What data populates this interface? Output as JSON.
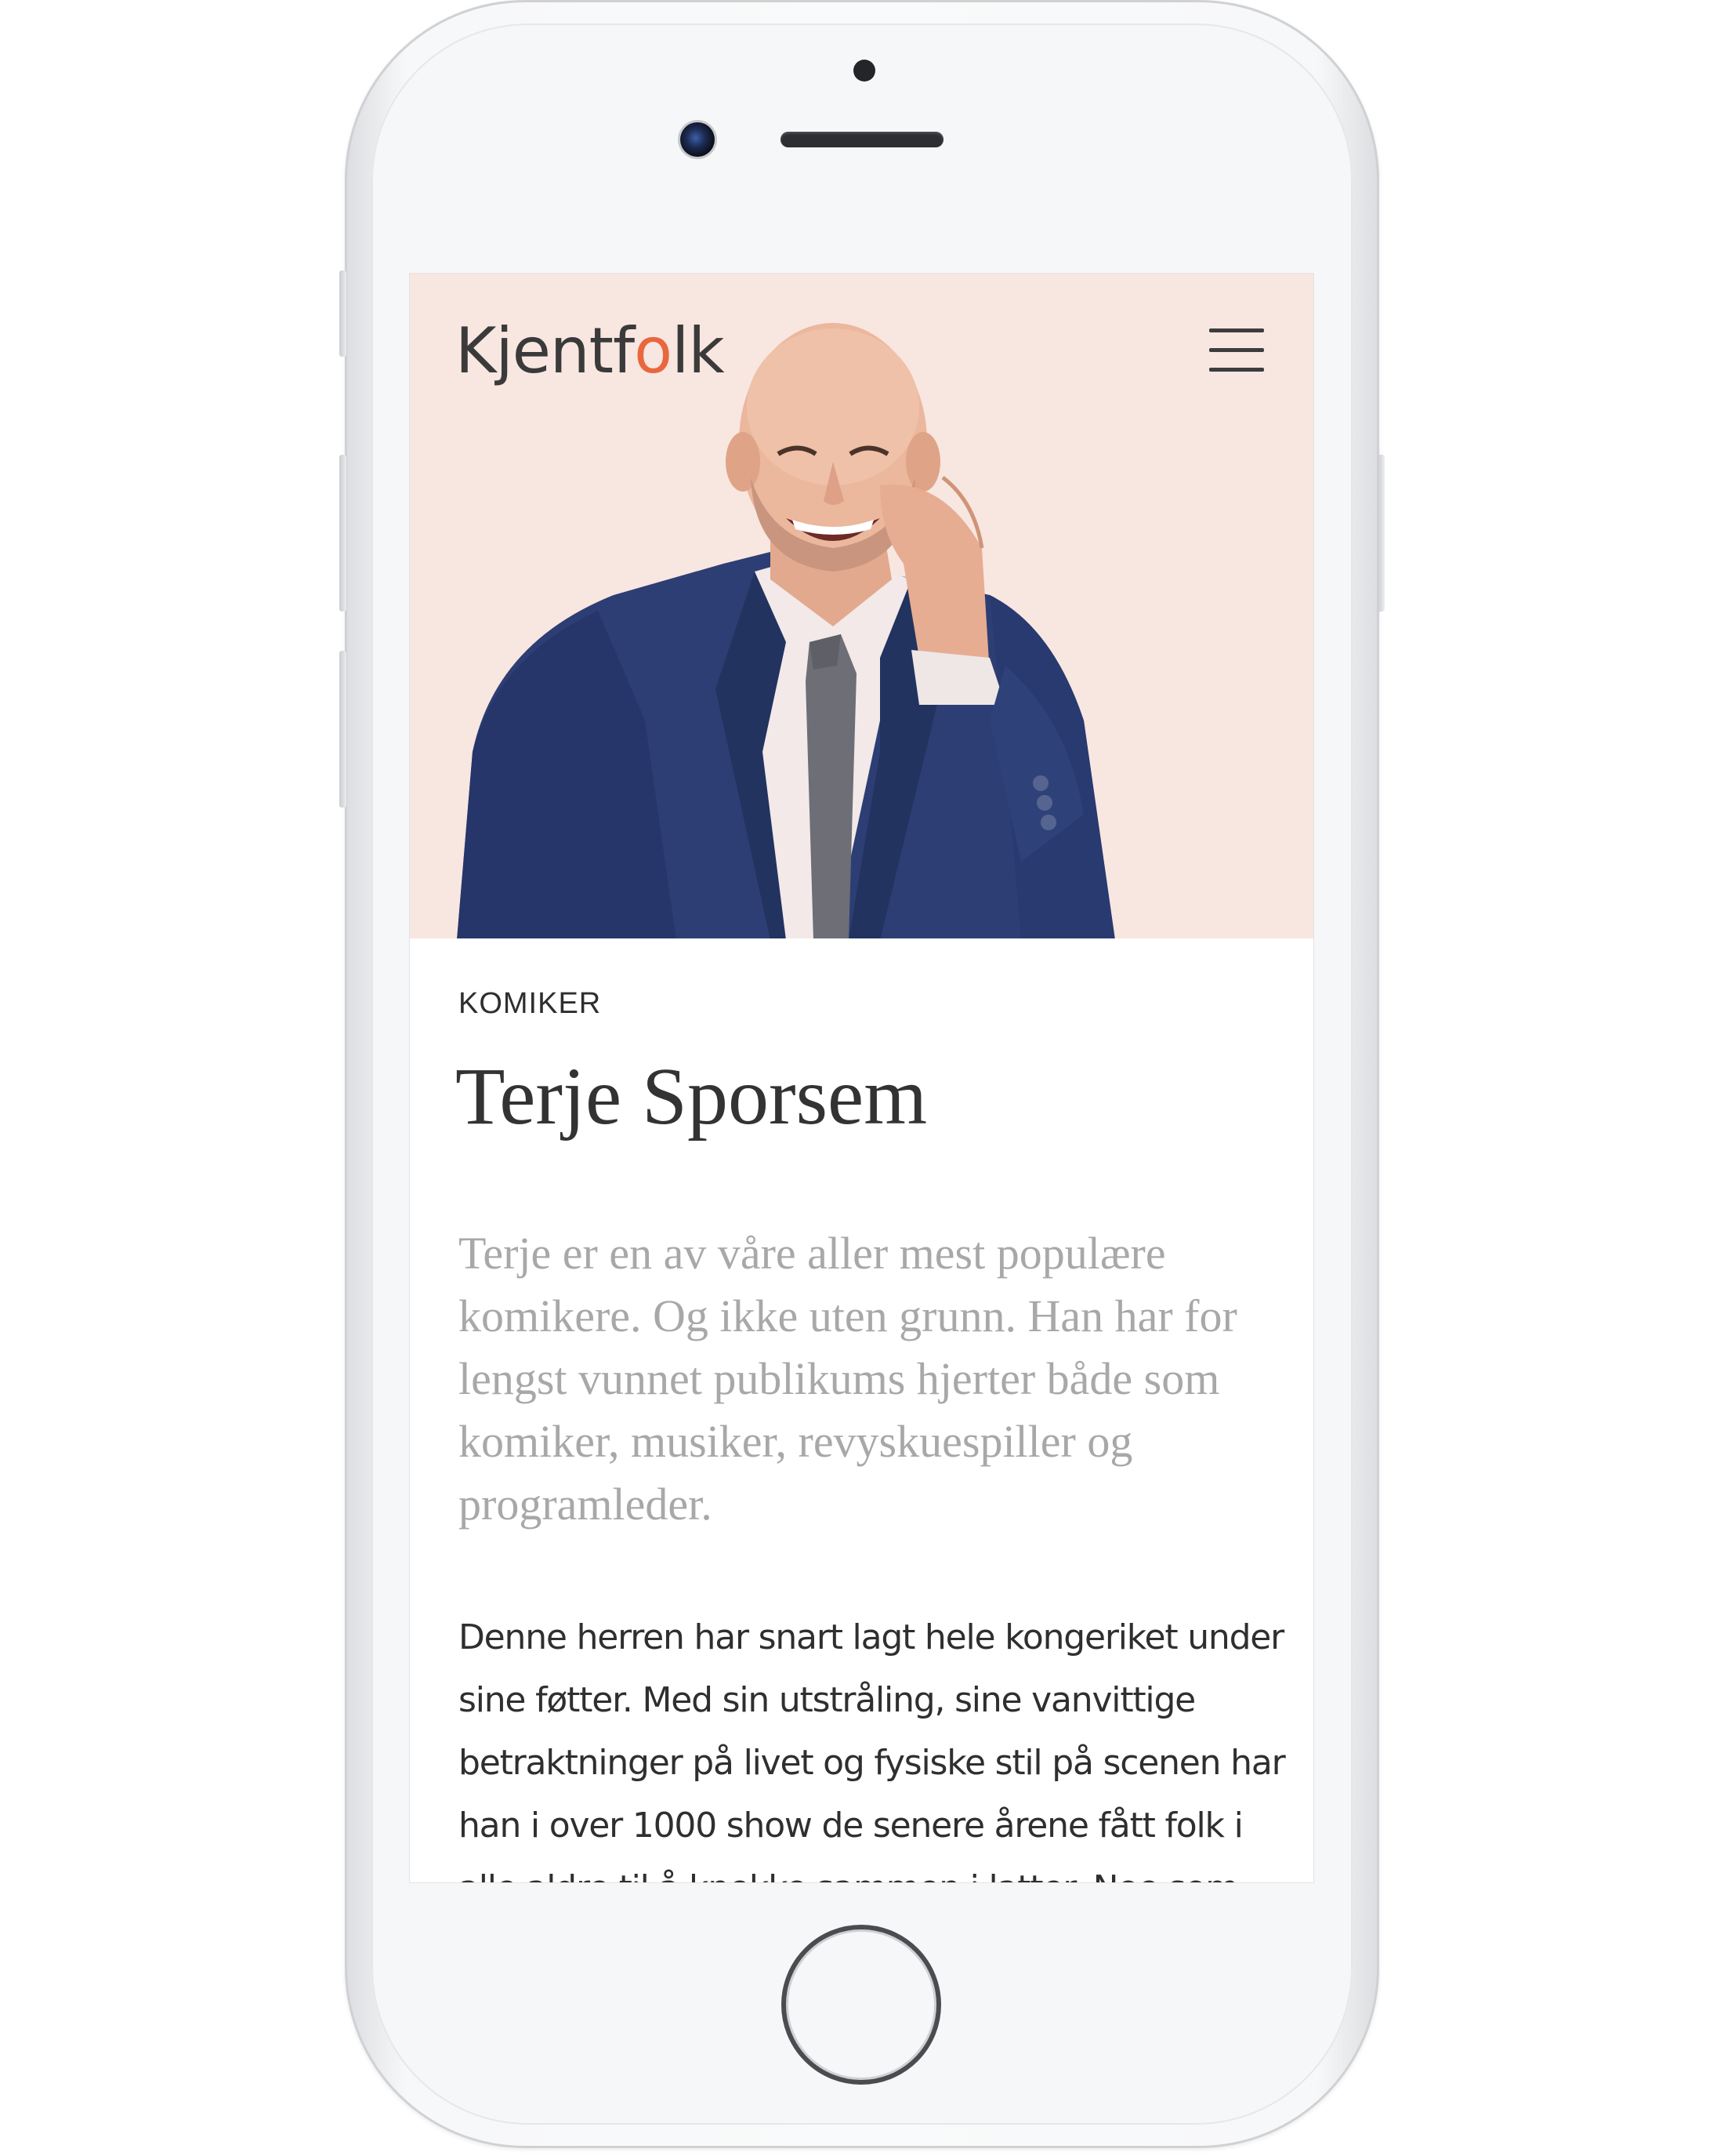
{
  "site": {
    "logo_before": "Kjentf",
    "logo_accent": "o",
    "logo_after": "lk",
    "brand_colors": {
      "accent": "#e9673e",
      "hero_background": "#f8e6e0",
      "text": "#333333",
      "lead_text": "#a8a8a8"
    }
  },
  "header": {
    "menu_icon": "hamburger-menu-icon"
  },
  "profile": {
    "category": "KOMIKER",
    "name": "Terje Sporsem",
    "lead": "Terje er en av våre aller mest populære komikere. Og ikke uten grunn. Han har for lengst vunnet publikums hjerter både som komiker, musiker, revyskuespiller og programleder.",
    "body_lines": [
      "Denne herren har snart lagt hele kongeriket under",
      "sine føtter. Med sin utstråling, sine vanvittige",
      "betraktninger på livet og fysiske stil på scenen har",
      "han i over 1000 show de senere årene fått folk i",
      "alle aldre til å knekke sammen i latter. Noe som"
    ]
  }
}
